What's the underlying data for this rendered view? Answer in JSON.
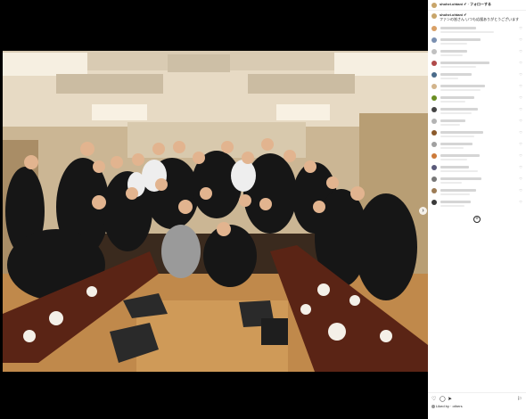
{
  "post": {
    "username": "shohei.ohtani ✔ · フォローする",
    "caption_user": "shohei.ohtani ✔",
    "caption_text": "ファンの皆さん いつも応援ありがとうございます",
    "likes_text": "Liked by · others",
    "load_more_symbol": "+"
  },
  "comments": [
    {
      "avatar_color": "#d9a066",
      "w1": 40,
      "w2": 60
    },
    {
      "avatar_color": "#7a8fb0",
      "w1": 45,
      "w2": 30
    },
    {
      "avatar_color": "#c0c0c0",
      "w1": 30,
      "w2": 25
    },
    {
      "avatar_color": "#b04a4a",
      "w1": 55,
      "w2": 40
    },
    {
      "avatar_color": "#4a6b8a",
      "w1": 35,
      "w2": 20
    },
    {
      "avatar_color": "#d2b48c",
      "w1": 50,
      "w2": 45
    },
    {
      "avatar_color": "#6b8e23",
      "w1": 38,
      "w2": 28
    },
    {
      "avatar_color": "#444444",
      "w1": 42,
      "w2": 35
    },
    {
      "avatar_color": "#b3b3b3",
      "w1": 28,
      "w2": 22
    },
    {
      "avatar_color": "#8b5a2b",
      "w1": 48,
      "w2": 38
    },
    {
      "avatar_color": "#a0a0a0",
      "w1": 36,
      "w2": 26
    },
    {
      "avatar_color": "#cc7a3a",
      "w1": 44,
      "w2": 30
    },
    {
      "avatar_color": "#5a5a7a",
      "w1": 32,
      "w2": 42
    },
    {
      "avatar_color": "#777777",
      "w1": 46,
      "w2": 24
    },
    {
      "avatar_color": "#9c7b55",
      "w1": 40,
      "w2": 33
    },
    {
      "avatar_color": "#3a3a3a",
      "w1": 34,
      "w2": 27
    }
  ],
  "icons": {
    "heart": "♡",
    "comment": "◯",
    "share": "➤",
    "bookmark": "⚐",
    "next": "›"
  },
  "colors": {
    "background": "#000000",
    "sidebar": "#ffffff",
    "text": "#262626"
  }
}
